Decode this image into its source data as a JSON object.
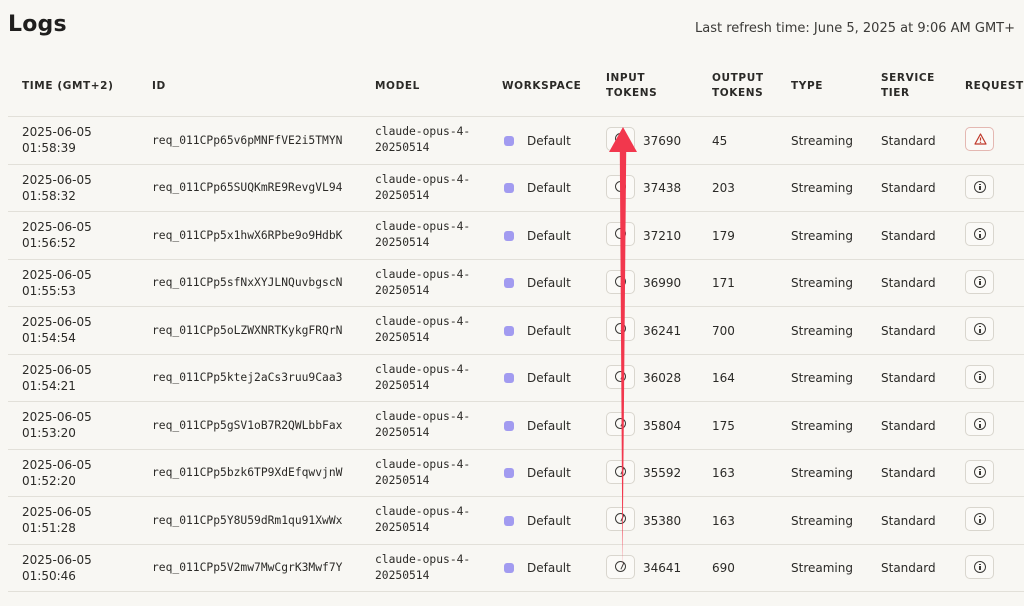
{
  "page": {
    "title": "Logs",
    "refresh_text": "Last refresh time: June 5, 2025 at 9:06 AM GMT+"
  },
  "table": {
    "headers": {
      "time": "TIME (GMT+2)",
      "id": "ID",
      "model": "MODEL",
      "workspace": "WORKSPACE",
      "input_tokens": [
        "INPUT",
        "TOKENS"
      ],
      "output_tokens": [
        "OUTPUT",
        "TOKENS"
      ],
      "type": "TYPE",
      "service_tier": [
        "SERVICE",
        "TIER"
      ],
      "request": "REQUEST"
    },
    "rows": [
      {
        "date": "2025-06-05",
        "time": "01:58:39",
        "id": "req_011CPp65v6pMNFfVE2i5TMYN",
        "model_a": "claude-opus-4-",
        "model_b": "20250514",
        "workspace": "Default",
        "input_tokens": "37690",
        "output_tokens": "45",
        "type": "Streaming",
        "tier": "Standard",
        "status": "error"
      },
      {
        "date": "2025-06-05",
        "time": "01:58:32",
        "id": "req_011CPp65SUQKmRE9RevgVL94",
        "model_a": "claude-opus-4-",
        "model_b": "20250514",
        "workspace": "Default",
        "input_tokens": "37438",
        "output_tokens": "203",
        "type": "Streaming",
        "tier": "Standard",
        "status": "info"
      },
      {
        "date": "2025-06-05",
        "time": "01:56:52",
        "id": "req_011CPp5x1hwX6RPbe9o9HdbK",
        "model_a": "claude-opus-4-",
        "model_b": "20250514",
        "workspace": "Default",
        "input_tokens": "37210",
        "output_tokens": "179",
        "type": "Streaming",
        "tier": "Standard",
        "status": "info"
      },
      {
        "date": "2025-06-05",
        "time": "01:55:53",
        "id": "req_011CPp5sfNxXYJLNQuvbgscN",
        "model_a": "claude-opus-4-",
        "model_b": "20250514",
        "workspace": "Default",
        "input_tokens": "36990",
        "output_tokens": "171",
        "type": "Streaming",
        "tier": "Standard",
        "status": "info"
      },
      {
        "date": "2025-06-05",
        "time": "01:54:54",
        "id": "req_011CPp5oLZWXNRTKykgFRQrN",
        "model_a": "claude-opus-4-",
        "model_b": "20250514",
        "workspace": "Default",
        "input_tokens": "36241",
        "output_tokens": "700",
        "type": "Streaming",
        "tier": "Standard",
        "status": "info"
      },
      {
        "date": "2025-06-05",
        "time": "01:54:21",
        "id": "req_011CPp5ktej2aCs3ruu9Caa3",
        "model_a": "claude-opus-4-",
        "model_b": "20250514",
        "workspace": "Default",
        "input_tokens": "36028",
        "output_tokens": "164",
        "type": "Streaming",
        "tier": "Standard",
        "status": "info"
      },
      {
        "date": "2025-06-05",
        "time": "01:53:20",
        "id": "req_011CPp5gSV1oB7R2QWLbbFax",
        "model_a": "claude-opus-4-",
        "model_b": "20250514",
        "workspace": "Default",
        "input_tokens": "35804",
        "output_tokens": "175",
        "type": "Streaming",
        "tier": "Standard",
        "status": "info"
      },
      {
        "date": "2025-06-05",
        "time": "01:52:20",
        "id": "req_011CPp5bzk6TP9XdEfqwvjnW",
        "model_a": "claude-opus-4-",
        "model_b": "20250514",
        "workspace": "Default",
        "input_tokens": "35592",
        "output_tokens": "163",
        "type": "Streaming",
        "tier": "Standard",
        "status": "info"
      },
      {
        "date": "2025-06-05",
        "time": "01:51:28",
        "id": "req_011CPp5Y8U59dRm1qu91XwWx",
        "model_a": "claude-opus-4-",
        "model_b": "20250514",
        "workspace": "Default",
        "input_tokens": "35380",
        "output_tokens": "163",
        "type": "Streaming",
        "tier": "Standard",
        "status": "info"
      },
      {
        "date": "2025-06-05",
        "time": "01:50:46",
        "id": "req_011CPp5V2mw7MwCgrK3Mwf7Y",
        "model_a": "claude-opus-4-",
        "model_b": "20250514",
        "workspace": "Default",
        "input_tokens": "34641",
        "output_tokens": "690",
        "type": "Streaming",
        "tier": "Standard",
        "status": "info"
      }
    ]
  },
  "icons": {
    "workspace_dot": "workspace-color-icon",
    "token_detail": "token-detail-icon",
    "request_info": "info-circle-icon",
    "request_error": "warning-triangle-icon",
    "annotation": "red-arrow-annotation"
  },
  "colors": {
    "background": "#f8f7f3",
    "workspace_dot": "#a29bf0",
    "error": "#c0392b",
    "annotation_arrow": "#f2374d"
  }
}
